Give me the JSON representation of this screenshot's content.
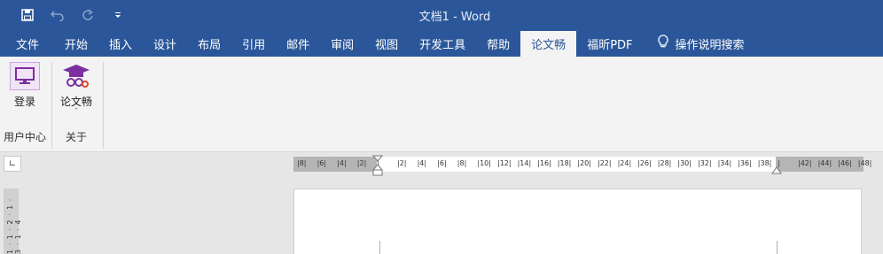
{
  "window": {
    "title": "文档1  -  Word"
  },
  "qat": {
    "save_icon": "save-icon",
    "undo_icon": "undo-icon",
    "redo_icon": "redo-icon",
    "customize_icon": "customize-qat-icon"
  },
  "tabs": [
    {
      "label": "文件"
    },
    {
      "label": "开始"
    },
    {
      "label": "插入"
    },
    {
      "label": "设计"
    },
    {
      "label": "布局"
    },
    {
      "label": "引用"
    },
    {
      "label": "邮件"
    },
    {
      "label": "审阅"
    },
    {
      "label": "视图"
    },
    {
      "label": "开发工具"
    },
    {
      "label": "帮助"
    },
    {
      "label": "论文畅"
    },
    {
      "label": "福昕PDF"
    }
  ],
  "active_tab": "论文畅",
  "tell_me": {
    "label": "操作说明搜索",
    "icon": "lightbulb-icon"
  },
  "ribbon": {
    "groups": [
      {
        "label": "用户中心",
        "button": {
          "label": "登录",
          "icon": "monitor-icon"
        }
      },
      {
        "label": "关于",
        "button": {
          "label": "论文畅",
          "icon": "graduation-cap-icon",
          "dropdown": "ˇ"
        }
      }
    ]
  },
  "ruler": {
    "corner_icon": "tab-stop-icon",
    "ticks": [
      "8",
      "6",
      "4",
      "2",
      "",
      "2",
      "4",
      "6",
      "8",
      "10",
      "12",
      "14",
      "16",
      "18",
      "20",
      "22",
      "24",
      "26",
      "28",
      "30",
      "32",
      "34",
      "36",
      "38",
      "",
      "42",
      "44",
      "46",
      "48"
    ],
    "vertical_ticks": "1 · 1 · 2 · 1 · 3 · 1 · 4"
  },
  "colors": {
    "accent": "#2b579a",
    "ribbon_bg": "#f3f3f3",
    "workspace_bg": "#e6e6e6",
    "icon_purple": "#7b2fa0"
  }
}
